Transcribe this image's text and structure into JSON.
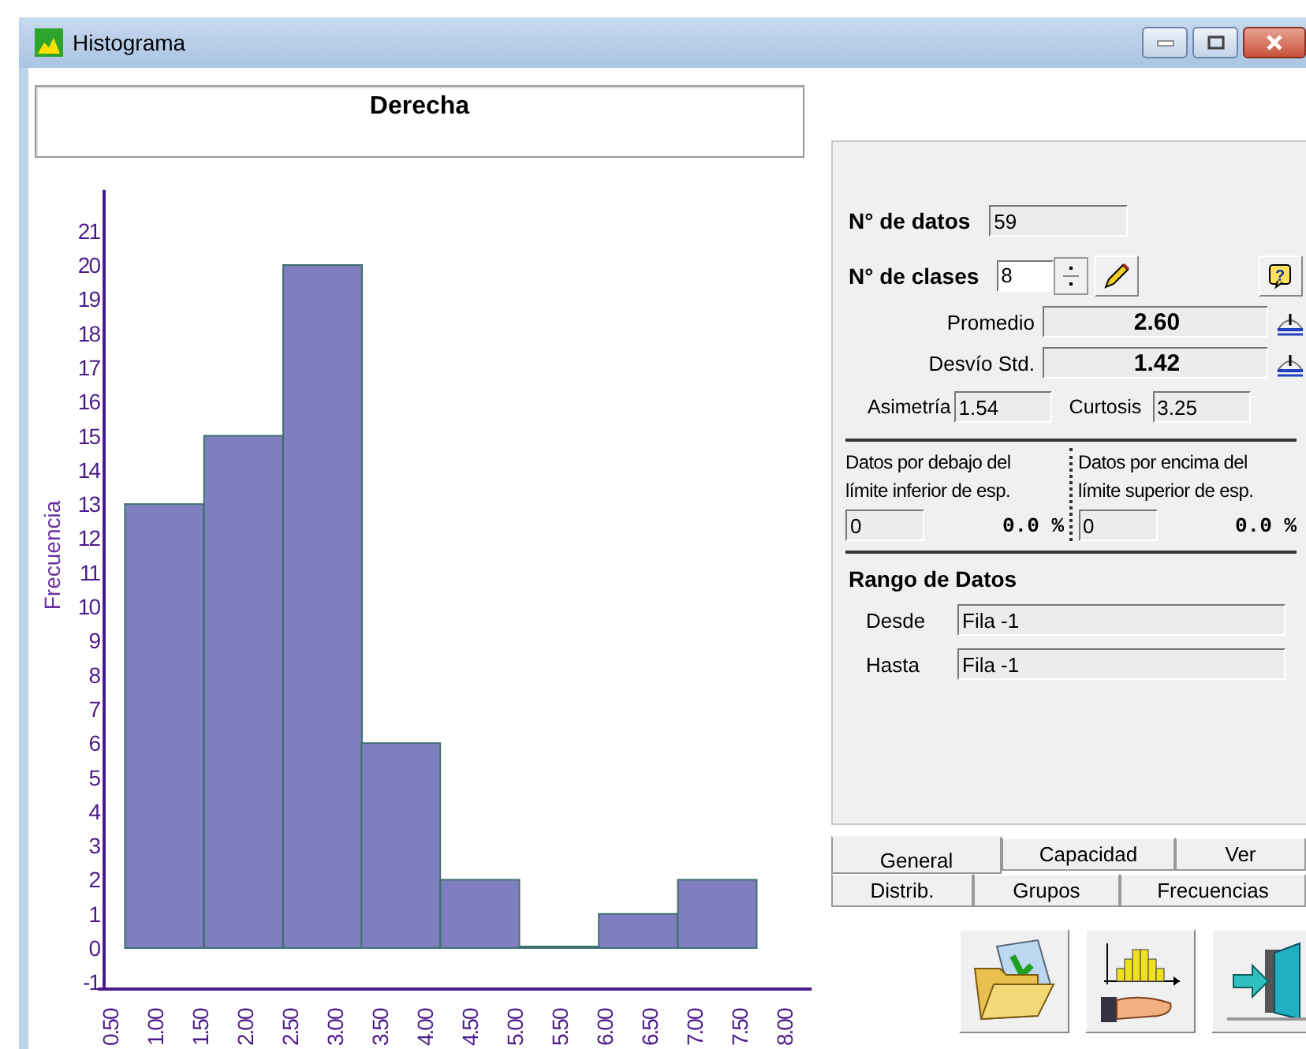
{
  "window": {
    "title": "Histograma"
  },
  "chart": {
    "title": "Derecha",
    "chart_data": {
      "type": "bar",
      "ylabel": "Frecuencia",
      "x": [
        1.1,
        1.98,
        2.86,
        3.73,
        4.61,
        5.49,
        6.37,
        7.25
      ],
      "values": [
        13,
        15,
        20,
        6,
        2,
        0,
        1,
        2
      ],
      "color": "#7f7fbf",
      "xlim": [
        0.43,
        8.3
      ],
      "ylim": [
        -1.2,
        22.2
      ],
      "yticks": [
        -1,
        0,
        1,
        2,
        3,
        4,
        5,
        6,
        7,
        8,
        9,
        10,
        11,
        12,
        13,
        14,
        15,
        16,
        17,
        18,
        19,
        20,
        21
      ],
      "xticks": [
        {
          "value": 0.5,
          "label": "0.50"
        },
        {
          "value": 1.0,
          "label": "1.00"
        },
        {
          "value": 1.5,
          "label": "1.50"
        },
        {
          "value": 2.0,
          "label": "2.00"
        },
        {
          "value": 2.5,
          "label": "2.50"
        },
        {
          "value": 3.0,
          "label": "3.00"
        },
        {
          "value": 3.5,
          "label": "3.50"
        },
        {
          "value": 4.0,
          "label": "4.00"
        },
        {
          "value": 4.5,
          "label": "4.50"
        },
        {
          "value": 5.0,
          "label": "5.00"
        },
        {
          "value": 5.5,
          "label": "5.50"
        },
        {
          "value": 6.0,
          "label": "6.00"
        },
        {
          "value": 6.5,
          "label": "6.50"
        },
        {
          "value": 7.0,
          "label": "7.00"
        },
        {
          "value": 7.5,
          "label": "7.50"
        },
        {
          "value": 8.0,
          "label": "8.00"
        }
      ]
    }
  },
  "panel": {
    "n_datos": {
      "label": "N° de datos",
      "value": "59"
    },
    "n_clases": {
      "label": "N° de clases",
      "value": "8"
    },
    "help_symbol": "?",
    "stats": [
      {
        "label": "Promedio",
        "value": "2.60"
      },
      {
        "label": "Desvío Std.",
        "value": "1.42"
      }
    ],
    "asimetria": {
      "label": "Asimetría",
      "value": "1.54"
    },
    "curtosis": {
      "label": "Curtosis",
      "value": "3.25"
    },
    "spec": [
      {
        "lines": [
          "Datos por debajo del",
          "límite inferior de esp."
        ],
        "count": "0",
        "percent": "0.0 %"
      },
      {
        "lines": [
          "Datos por encima del",
          "límite superior de esp."
        ],
        "count": "0",
        "percent": "0.0 %"
      }
    ],
    "range": {
      "title": "Rango de Datos",
      "rows": [
        {
          "label": "Desde",
          "value": "Fila -1"
        },
        {
          "label": "Hasta",
          "value": "Fila -1"
        }
      ]
    }
  },
  "tabs": [
    [
      {
        "label": "General",
        "selected": true
      },
      {
        "label": "Capacidad",
        "selected": false
      },
      {
        "label": "Ver",
        "selected": false
      }
    ],
    [
      {
        "label": "Distrib.",
        "selected": false
      },
      {
        "label": "Grupos",
        "selected": false
      },
      {
        "label": "Frecuencias",
        "selected": false
      }
    ]
  ]
}
